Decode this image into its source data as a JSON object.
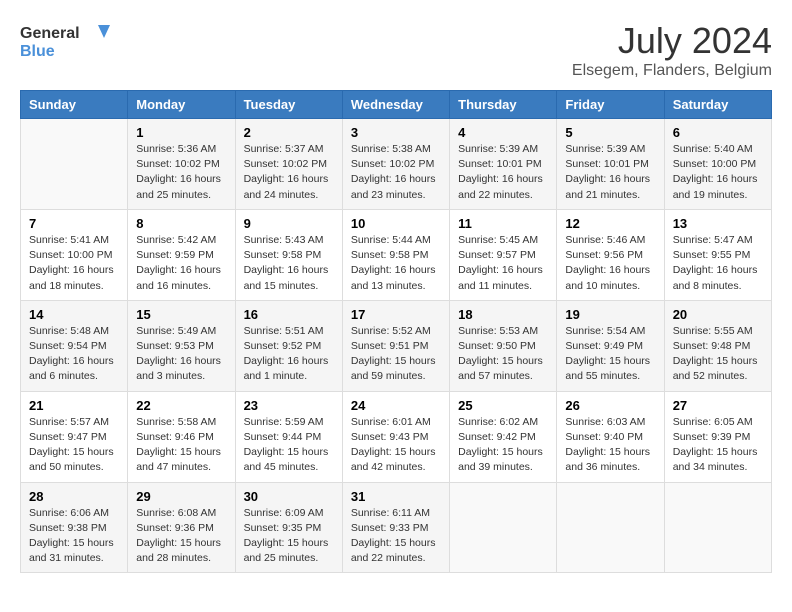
{
  "header": {
    "logo_line1": "General",
    "logo_line2": "Blue",
    "month_year": "July 2024",
    "location": "Elsegem, Flanders, Belgium"
  },
  "weekdays": [
    "Sunday",
    "Monday",
    "Tuesday",
    "Wednesday",
    "Thursday",
    "Friday",
    "Saturday"
  ],
  "weeks": [
    [
      {
        "day": "",
        "info": ""
      },
      {
        "day": "1",
        "info": "Sunrise: 5:36 AM\nSunset: 10:02 PM\nDaylight: 16 hours\nand 25 minutes."
      },
      {
        "day": "2",
        "info": "Sunrise: 5:37 AM\nSunset: 10:02 PM\nDaylight: 16 hours\nand 24 minutes."
      },
      {
        "day": "3",
        "info": "Sunrise: 5:38 AM\nSunset: 10:02 PM\nDaylight: 16 hours\nand 23 minutes."
      },
      {
        "day": "4",
        "info": "Sunrise: 5:39 AM\nSunset: 10:01 PM\nDaylight: 16 hours\nand 22 minutes."
      },
      {
        "day": "5",
        "info": "Sunrise: 5:39 AM\nSunset: 10:01 PM\nDaylight: 16 hours\nand 21 minutes."
      },
      {
        "day": "6",
        "info": "Sunrise: 5:40 AM\nSunset: 10:00 PM\nDaylight: 16 hours\nand 19 minutes."
      }
    ],
    [
      {
        "day": "7",
        "info": "Sunrise: 5:41 AM\nSunset: 10:00 PM\nDaylight: 16 hours\nand 18 minutes."
      },
      {
        "day": "8",
        "info": "Sunrise: 5:42 AM\nSunset: 9:59 PM\nDaylight: 16 hours\nand 16 minutes."
      },
      {
        "day": "9",
        "info": "Sunrise: 5:43 AM\nSunset: 9:58 PM\nDaylight: 16 hours\nand 15 minutes."
      },
      {
        "day": "10",
        "info": "Sunrise: 5:44 AM\nSunset: 9:58 PM\nDaylight: 16 hours\nand 13 minutes."
      },
      {
        "day": "11",
        "info": "Sunrise: 5:45 AM\nSunset: 9:57 PM\nDaylight: 16 hours\nand 11 minutes."
      },
      {
        "day": "12",
        "info": "Sunrise: 5:46 AM\nSunset: 9:56 PM\nDaylight: 16 hours\nand 10 minutes."
      },
      {
        "day": "13",
        "info": "Sunrise: 5:47 AM\nSunset: 9:55 PM\nDaylight: 16 hours\nand 8 minutes."
      }
    ],
    [
      {
        "day": "14",
        "info": "Sunrise: 5:48 AM\nSunset: 9:54 PM\nDaylight: 16 hours\nand 6 minutes."
      },
      {
        "day": "15",
        "info": "Sunrise: 5:49 AM\nSunset: 9:53 PM\nDaylight: 16 hours\nand 3 minutes."
      },
      {
        "day": "16",
        "info": "Sunrise: 5:51 AM\nSunset: 9:52 PM\nDaylight: 16 hours\nand 1 minute."
      },
      {
        "day": "17",
        "info": "Sunrise: 5:52 AM\nSunset: 9:51 PM\nDaylight: 15 hours\nand 59 minutes."
      },
      {
        "day": "18",
        "info": "Sunrise: 5:53 AM\nSunset: 9:50 PM\nDaylight: 15 hours\nand 57 minutes."
      },
      {
        "day": "19",
        "info": "Sunrise: 5:54 AM\nSunset: 9:49 PM\nDaylight: 15 hours\nand 55 minutes."
      },
      {
        "day": "20",
        "info": "Sunrise: 5:55 AM\nSunset: 9:48 PM\nDaylight: 15 hours\nand 52 minutes."
      }
    ],
    [
      {
        "day": "21",
        "info": "Sunrise: 5:57 AM\nSunset: 9:47 PM\nDaylight: 15 hours\nand 50 minutes."
      },
      {
        "day": "22",
        "info": "Sunrise: 5:58 AM\nSunset: 9:46 PM\nDaylight: 15 hours\nand 47 minutes."
      },
      {
        "day": "23",
        "info": "Sunrise: 5:59 AM\nSunset: 9:44 PM\nDaylight: 15 hours\nand 45 minutes."
      },
      {
        "day": "24",
        "info": "Sunrise: 6:01 AM\nSunset: 9:43 PM\nDaylight: 15 hours\nand 42 minutes."
      },
      {
        "day": "25",
        "info": "Sunrise: 6:02 AM\nSunset: 9:42 PM\nDaylight: 15 hours\nand 39 minutes."
      },
      {
        "day": "26",
        "info": "Sunrise: 6:03 AM\nSunset: 9:40 PM\nDaylight: 15 hours\nand 36 minutes."
      },
      {
        "day": "27",
        "info": "Sunrise: 6:05 AM\nSunset: 9:39 PM\nDaylight: 15 hours\nand 34 minutes."
      }
    ],
    [
      {
        "day": "28",
        "info": "Sunrise: 6:06 AM\nSunset: 9:38 PM\nDaylight: 15 hours\nand 31 minutes."
      },
      {
        "day": "29",
        "info": "Sunrise: 6:08 AM\nSunset: 9:36 PM\nDaylight: 15 hours\nand 28 minutes."
      },
      {
        "day": "30",
        "info": "Sunrise: 6:09 AM\nSunset: 9:35 PM\nDaylight: 15 hours\nand 25 minutes."
      },
      {
        "day": "31",
        "info": "Sunrise: 6:11 AM\nSunset: 9:33 PM\nDaylight: 15 hours\nand 22 minutes."
      },
      {
        "day": "",
        "info": ""
      },
      {
        "day": "",
        "info": ""
      },
      {
        "day": "",
        "info": ""
      }
    ]
  ]
}
